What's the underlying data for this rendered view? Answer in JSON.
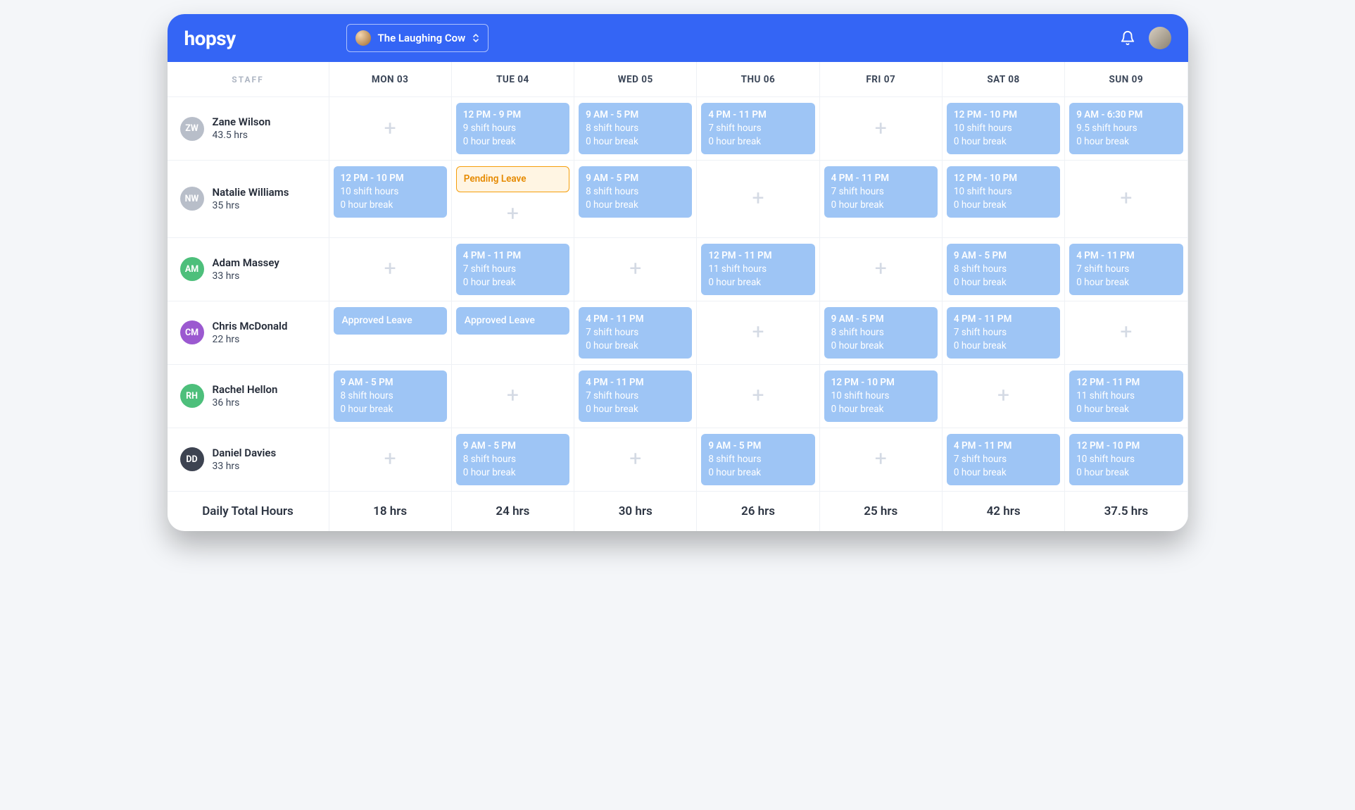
{
  "header": {
    "logo_text": "hopsy",
    "venue_name": "The Laughing Cow"
  },
  "staff_header": "STAFF",
  "days": [
    "MON 03",
    "TUE 04",
    "WED 05",
    "THU 06",
    "FRI 07",
    "SAT 08",
    "SUN 09"
  ],
  "staff": [
    {
      "initials": "ZW",
      "name": "Zane Wilson",
      "hours": "43.5 hrs",
      "color": "#B8BEC9",
      "cells": [
        {
          "type": "empty"
        },
        {
          "type": "shift",
          "time": "12 PM - 9 PM",
          "shift": "9 shift hours",
          "break": "0 hour break"
        },
        {
          "type": "shift",
          "time": "9 AM - 5 PM",
          "shift": "8 shift hours",
          "break": "0 hour break"
        },
        {
          "type": "shift",
          "time": "4 PM - 11 PM",
          "shift": "7 shift hours",
          "break": "0 hour break"
        },
        {
          "type": "empty"
        },
        {
          "type": "shift",
          "time": "12 PM - 10 PM",
          "shift": "10 shift hours",
          "break": "0 hour break"
        },
        {
          "type": "shift",
          "time": "9 AM - 6:30 PM",
          "shift": "9.5 shift hours",
          "break": "0 hour break"
        }
      ]
    },
    {
      "initials": "NW",
      "name": "Natalie Williams",
      "hours": "35 hrs",
      "color": "#B8BEC9",
      "cells": [
        {
          "type": "shift",
          "time": "12 PM - 10 PM",
          "shift": "10 shift hours",
          "break": "0 hour break"
        },
        {
          "type": "pending_with_empty",
          "label": "Pending Leave"
        },
        {
          "type": "shift",
          "time": "9 AM - 5 PM",
          "shift": "8 shift hours",
          "break": "0 hour break"
        },
        {
          "type": "empty"
        },
        {
          "type": "shift",
          "time": "4 PM - 11 PM",
          "shift": "7 shift hours",
          "break": "0 hour break"
        },
        {
          "type": "shift",
          "time": "12 PM - 10 PM",
          "shift": "10 shift hours",
          "break": "0 hour break"
        },
        {
          "type": "empty"
        }
      ]
    },
    {
      "initials": "AM",
      "name": "Adam Massey",
      "hours": "33 hrs",
      "color": "#4DBF7B",
      "cells": [
        {
          "type": "empty"
        },
        {
          "type": "shift",
          "time": "4 PM - 11 PM",
          "shift": "7 shift hours",
          "break": "0 hour break"
        },
        {
          "type": "empty"
        },
        {
          "type": "shift",
          "time": "12 PM - 11 PM",
          "shift": "11 shift hours",
          "break": "0 hour break"
        },
        {
          "type": "empty"
        },
        {
          "type": "shift",
          "time": "9 AM - 5 PM",
          "shift": "8 shift hours",
          "break": "0 hour break"
        },
        {
          "type": "shift",
          "time": "4 PM - 11 PM",
          "shift": "7 shift hours",
          "break": "0 hour break"
        }
      ]
    },
    {
      "initials": "CM",
      "name": "Chris McDonald",
      "hours": "22 hrs",
      "color": "#9B59D0",
      "cells": [
        {
          "type": "approved",
          "label": "Approved Leave"
        },
        {
          "type": "approved",
          "label": "Approved Leave"
        },
        {
          "type": "shift",
          "time": "4 PM - 11 PM",
          "shift": "7 shift hours",
          "break": "0 hour break"
        },
        {
          "type": "empty"
        },
        {
          "type": "shift",
          "time": "9 AM - 5 PM",
          "shift": "8 shift hours",
          "break": "0 hour break"
        },
        {
          "type": "shift",
          "time": "4 PM - 11 PM",
          "shift": "7 shift hours",
          "break": "0 hour break"
        },
        {
          "type": "empty"
        }
      ]
    },
    {
      "initials": "RH",
      "name": "Rachel Hellon",
      "hours": "36 hrs",
      "color": "#4DBF7B",
      "cells": [
        {
          "type": "shift",
          "time": "9 AM - 5 PM",
          "shift": "8 shift hours",
          "break": "0 hour break"
        },
        {
          "type": "empty"
        },
        {
          "type": "shift",
          "time": "4 PM - 11 PM",
          "shift": "7 shift hours",
          "break": "0 hour break"
        },
        {
          "type": "empty"
        },
        {
          "type": "shift",
          "time": "12 PM - 10 PM",
          "shift": "10 shift hours",
          "break": "0 hour break"
        },
        {
          "type": "empty"
        },
        {
          "type": "shift",
          "time": "12 PM - 11 PM",
          "shift": "11 shift hours",
          "break": "0 hour break"
        }
      ]
    },
    {
      "initials": "DD",
      "name": "Daniel Davies",
      "hours": "33 hrs",
      "color": "#3D4351",
      "cells": [
        {
          "type": "empty"
        },
        {
          "type": "shift",
          "time": "9 AM - 5 PM",
          "shift": "8 shift hours",
          "break": "0 hour break"
        },
        {
          "type": "empty"
        },
        {
          "type": "shift",
          "time": "9 AM - 5 PM",
          "shift": "8 shift hours",
          "break": "0 hour break"
        },
        {
          "type": "empty"
        },
        {
          "type": "shift",
          "time": "4 PM - 11 PM",
          "shift": "7 shift hours",
          "break": "0 hour break"
        },
        {
          "type": "shift",
          "time": "12 PM - 10 PM",
          "shift": "10 shift hours",
          "break": "0 hour break"
        }
      ]
    }
  ],
  "footer": {
    "label": "Daily Total Hours",
    "totals": [
      "18 hrs",
      "24 hrs",
      "30 hrs",
      "26 hrs",
      "25 hrs",
      "42 hrs",
      "37.5 hrs"
    ]
  }
}
